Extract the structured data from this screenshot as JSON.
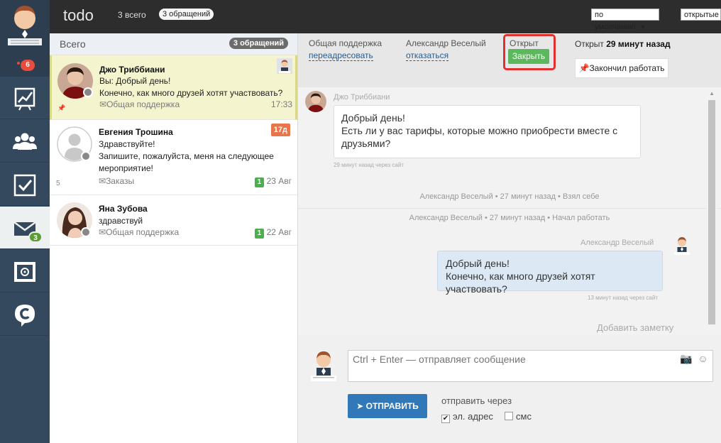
{
  "app": {
    "title": "todo",
    "total_label": "3 всего",
    "requests_pill": "3 обращений",
    "sort_select": "по умолчанию",
    "status_select": "открытые"
  },
  "nav": {
    "badge_unread": "6",
    "mail_count": "3"
  },
  "list": {
    "header_label": "Всего",
    "header_count": "3 обращений",
    "items": [
      {
        "name": "Джо Триббиани",
        "line1": "Вы: Добрый день!",
        "line2": "Конечно, как много друзей хотят участвовать?",
        "group": "Общая поддержка",
        "time": "17:33",
        "selected": true
      },
      {
        "name": "Евгения Трошина",
        "line1": "Здравствуйте!",
        "line2": "Запишите, пожалуйста, меня на следующее мероприятие!",
        "group": "Заказы",
        "tag": "1",
        "time": "23 Авг",
        "age_badge": "17д",
        "side_number": "5"
      },
      {
        "name": "Яна Зубова",
        "line1": "здравствуй",
        "group": "Общая поддержка",
        "tag": "1",
        "time": "22 Авг"
      }
    ]
  },
  "header": {
    "group_label": "Общая поддержка",
    "forward_link": "переадресовать",
    "agent_label": "Александр Веселый",
    "refuse_link": "отказаться",
    "status_label": "Открыт",
    "close_button": "Закрыть",
    "opened_prefix": "Открыт",
    "opened_ago": "29 минут назад",
    "finish_button": "Закончил работать"
  },
  "messages": {
    "in_author": "Джо Триббиани",
    "in_line1": "Добрый день!",
    "in_line2": "Есть ли у вас тарифы, которые можно приобрести вместе с друзьями?",
    "in_meta": "29 минут назад через сайт",
    "sys1": "Александр Веселый • 27 минут назад • Взял себе",
    "sys2": "Александр Веселый • 27 минут назад • Начал работать",
    "out_author": "Александр Веселый",
    "out_line1": "Добрый день!",
    "out_line2": "Конечно, как много друзей хотят участвовать?",
    "out_meta": "13 минут назад через сайт",
    "add_note": "Добавить заметку"
  },
  "composer": {
    "placeholder": "Ctrl + Enter — отправляет сообщение",
    "send_button": "ОТПРАВИТЬ",
    "send_via": "отправить через",
    "email_option": "эл. адрес",
    "sms_option": "смс"
  },
  "colors": {
    "close_green": "#5cb85c",
    "send_blue": "#3178b8",
    "highlight_red": "#e03131",
    "selected_row": "#f4f4cf"
  }
}
